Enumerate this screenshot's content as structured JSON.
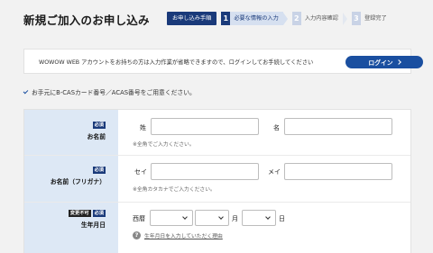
{
  "header": {
    "title": "新規ご加入のお申し込み",
    "steps_label": "お申し込み手順",
    "steps": [
      {
        "num": "1",
        "label": "必要な情報の入力"
      },
      {
        "num": "2",
        "label": "入力内容確認"
      },
      {
        "num": "3",
        "label": "登録完了"
      }
    ]
  },
  "login": {
    "text": "WOWOW WEB アカウントをお持ちの方は入力作業が省略できますので、ログインしてお手続してください",
    "button": "ログイン"
  },
  "notice": "お手元にB-CASカード番号／ACAS番号をご用意ください。",
  "form": {
    "name": {
      "badge_required": "必須",
      "label": "お名前",
      "last_label": "姓",
      "first_label": "名",
      "last_value": "",
      "first_value": "",
      "hint": "※全角でご入力ください。"
    },
    "kana": {
      "badge_required": "必須",
      "label": "お名前（フリガナ）",
      "last_label": "セイ",
      "first_label": "メイ",
      "last_value": "",
      "first_value": "",
      "hint": "※全角カタカナでご入力ください。"
    },
    "birth": {
      "badge_fixed": "変更不可",
      "badge_required": "必須",
      "label": "生年月日",
      "era_label": "西暦",
      "year_value": "",
      "month_value": "",
      "day_value": "",
      "month_unit": "月",
      "day_unit": "日",
      "help": "生年月日を入力していただく理由"
    }
  },
  "colors": {
    "accent": "#1a3a7a",
    "button": "#1a4fa0",
    "label_bg": "#dde8f5"
  }
}
